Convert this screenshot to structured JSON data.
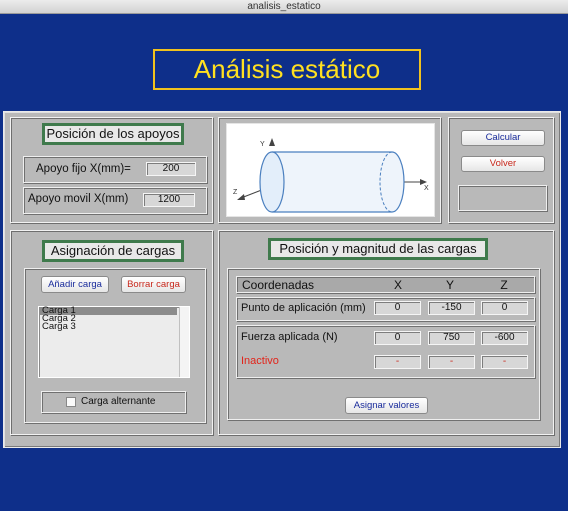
{
  "window": {
    "title": "analisis_estatico"
  },
  "header": {
    "title": "Análisis estático"
  },
  "supports": {
    "heading": "Posición de los apoyos",
    "fixed_label": "Apoyo fijo X(mm)=",
    "fixed_value": "200",
    "movable_label": "Apoyo movil X(mm)",
    "movable_value": "1200"
  },
  "diagram": {
    "axes": [
      "Y",
      "Z",
      "X"
    ]
  },
  "actions": {
    "calculate": "Calcular",
    "back": "Volver"
  },
  "loads": {
    "heading": "Asignación de cargas",
    "add_button": "Añadir carga",
    "delete_button": "Borrar carga",
    "items": [
      "Carga 1",
      "Carga 2",
      "Carga 3"
    ],
    "alternate_label": "Carga alternante"
  },
  "magnitude": {
    "heading": "Posición y magnitud de las cargas",
    "columns": {
      "label": "Coordenadas",
      "x": "X",
      "y": "Y",
      "z": "Z"
    },
    "application_point": {
      "label": "Punto de aplicación (mm)",
      "x": "0",
      "y": "-150",
      "z": "0"
    },
    "applied_force": {
      "label": "Fuerza aplicada (N)",
      "x": "0",
      "y": "750",
      "z": "-600"
    },
    "inactive": {
      "label": "Inactivo",
      "x": "-",
      "y": "-",
      "z": "-"
    },
    "assign_button": "Asignar valores"
  },
  "colors": {
    "background": "#0e2f8a",
    "title_text": "#ffe020",
    "title_border": "#f0c21e",
    "heading_border": "#3f7a4c",
    "inactive": "#e2241a"
  }
}
